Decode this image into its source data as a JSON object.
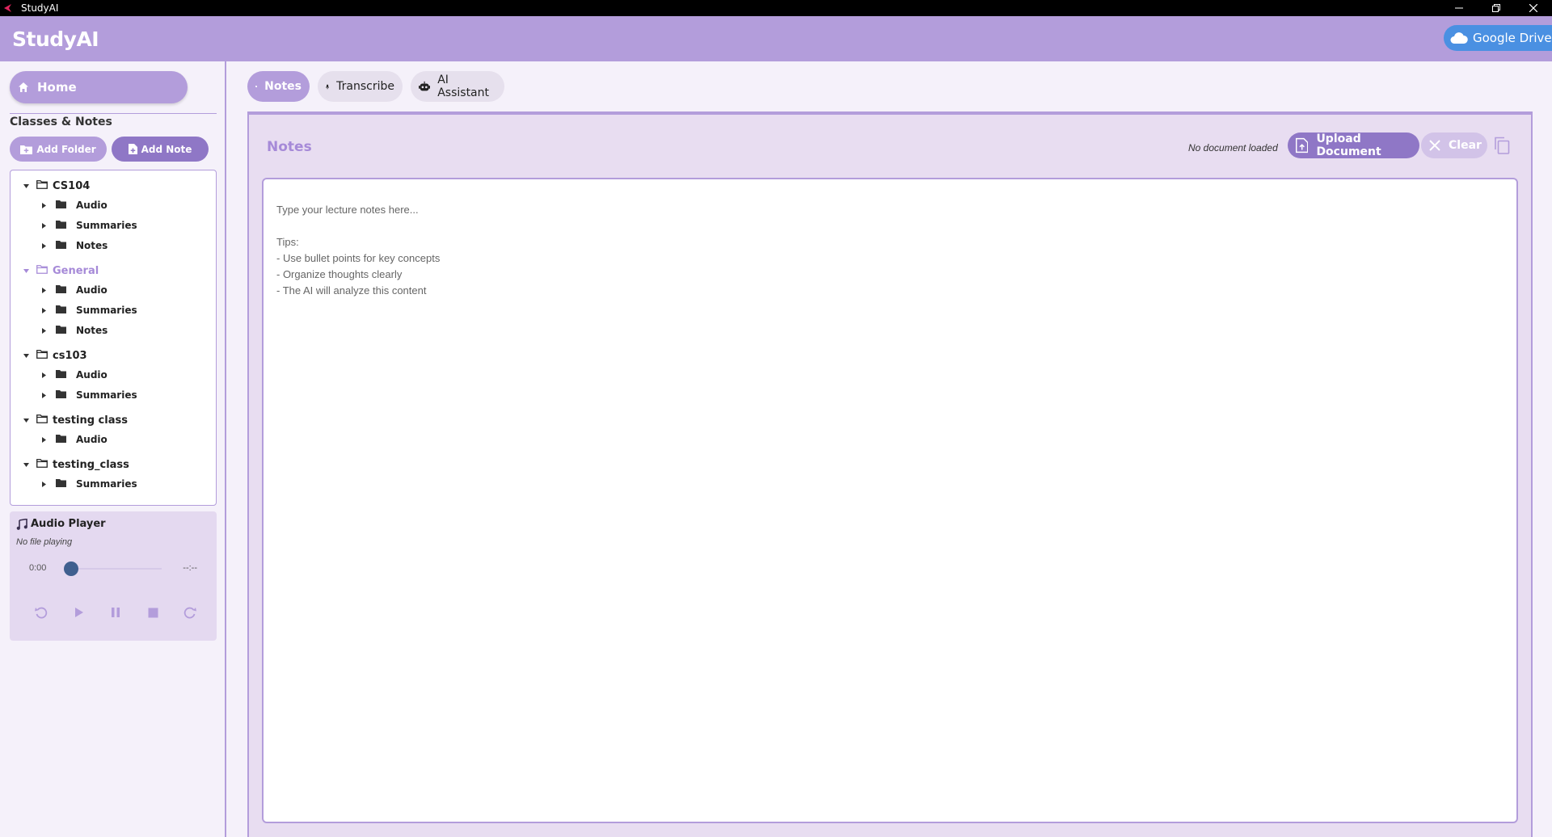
{
  "window": {
    "title": "StudyAI"
  },
  "header": {
    "app_title": "StudyAI",
    "drive_button": "Google Drive"
  },
  "sidebar": {
    "home_label": "Home",
    "section_title": "Classes & Notes",
    "add_folder_label": "Add Folder",
    "add_note_label": "Add Note",
    "tree": [
      {
        "label": "CS104",
        "level": 0
      },
      {
        "label": "Audio",
        "level": 1
      },
      {
        "label": "Summaries",
        "level": 1
      },
      {
        "label": "Notes",
        "level": 1
      },
      {
        "label": "General",
        "level": 0,
        "selected": true
      },
      {
        "label": "Audio",
        "level": 1
      },
      {
        "label": "Summaries",
        "level": 1
      },
      {
        "label": "Notes",
        "level": 1
      },
      {
        "label": "cs103",
        "level": 0
      },
      {
        "label": "Audio",
        "level": 1
      },
      {
        "label": "Summaries",
        "level": 1
      },
      {
        "label": "testing class",
        "level": 0
      },
      {
        "label": "Audio",
        "level": 1
      },
      {
        "label": "testing_class",
        "level": 0
      },
      {
        "label": "Summaries",
        "level": 1
      }
    ],
    "player": {
      "title": "Audio Player",
      "status": "No file playing",
      "time_current": "0:00",
      "time_total": "--:--",
      "progress": 0
    }
  },
  "tabs": [
    {
      "label": "Notes",
      "active": true
    },
    {
      "label": "Transcribe",
      "active": false
    },
    {
      "label": "AI Assistant",
      "active": false
    }
  ],
  "notes": {
    "title": "Notes",
    "doc_status": "No document loaded",
    "upload_label": "Upload Document",
    "clear_label": "Clear",
    "placeholder": "Type your lecture notes here...\n\nTips:\n- Use bullet points for key concepts\n- Organize thoughts clearly\n- The AI will analyze this content"
  },
  "colors": {
    "accent": "#b39ddb",
    "accent_dark": "#8f77c6",
    "panel_bg": "#e8ddf1",
    "drive_blue": "#4a90e2",
    "player_knob": "#3f5f8f"
  }
}
